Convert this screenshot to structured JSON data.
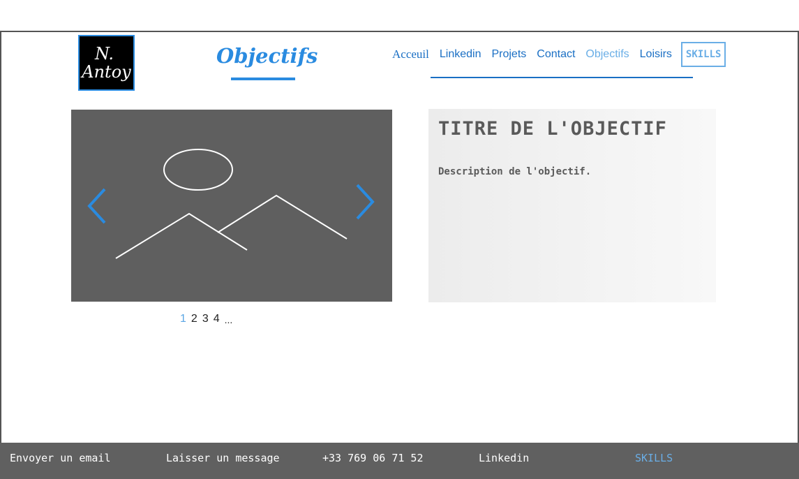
{
  "logo": {
    "line1": "N.",
    "line2": "Antoy"
  },
  "page_title": "Objectifs",
  "nav": {
    "items": [
      {
        "label": "Acceuil"
      },
      {
        "label": "Linkedin"
      },
      {
        "label": "Projets"
      },
      {
        "label": "Contact"
      },
      {
        "label": "Objectifs"
      },
      {
        "label": "Loisirs"
      }
    ],
    "skills": "SKILLS"
  },
  "carousel": {
    "pages": [
      "1",
      "2",
      "3",
      "4",
      "..."
    ],
    "current_page": "1"
  },
  "objective": {
    "title": "TITRE DE L'OBJECTIF",
    "description": "Description de l'objectif."
  },
  "footer": {
    "email": "Envoyer un email",
    "message": "Laisser un message",
    "phone": "+33 769 06 71 52",
    "linkedin": "Linkedin",
    "skills": "SKILLS"
  },
  "colors": {
    "accent": "#2a8be0",
    "nav_link": "#1a6fc4",
    "active_link": "#6aaee6",
    "carousel_bg": "#5f5f5f",
    "footer_bg": "#606060"
  }
}
